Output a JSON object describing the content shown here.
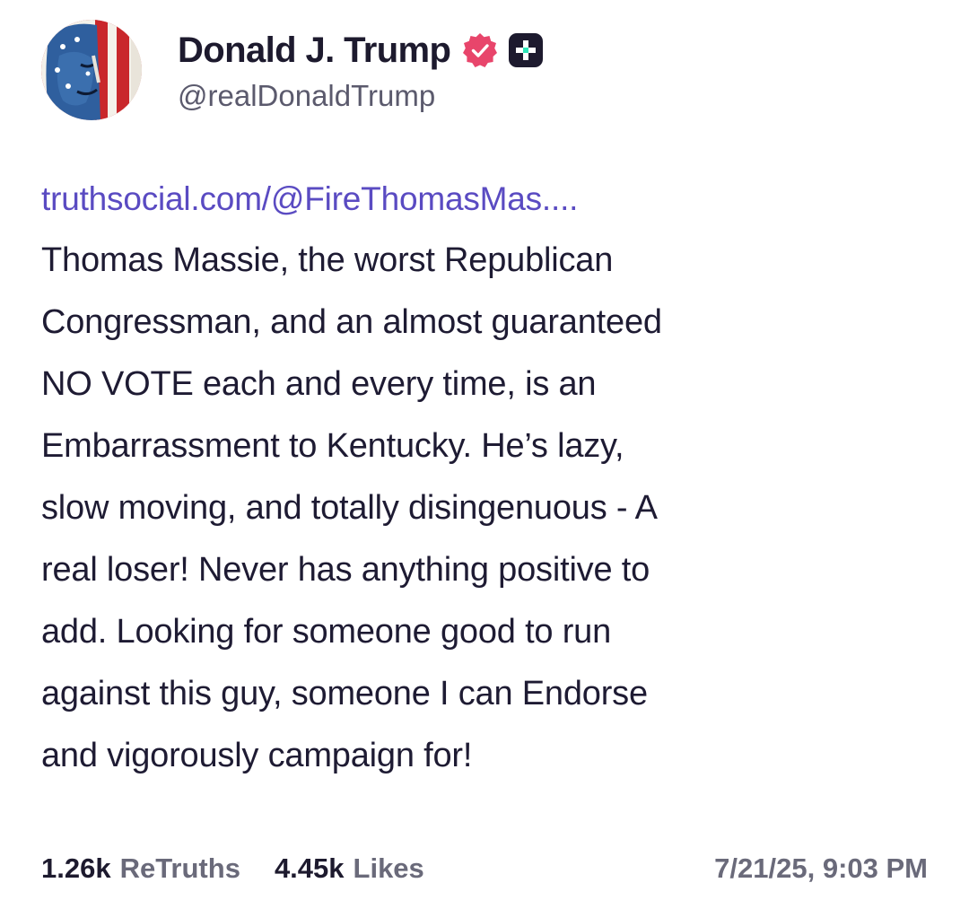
{
  "author": {
    "display_name": "Donald J. Trump",
    "handle": "@realDonaldTrump",
    "verified_icon": "verified-badge-icon",
    "plus_icon": "plus-badge-icon",
    "verified_color": "#e8456b"
  },
  "post": {
    "link_text": "truthsocial.com/@FireThomasMas....",
    "text_lines": [
      "Thomas Massie, the worst Republican",
      "Congressman, and an almost guaranteed",
      "NO VOTE each and every time, is an",
      "Embarrassment to Kentucky. He’s lazy,",
      "slow moving, and totally disingenuous - A",
      "real loser! Never has anything positive to",
      "add. Looking for someone good to run",
      "against this guy, someone I can Endorse",
      "and vigorously campaign for!"
    ]
  },
  "stats": {
    "retruths_count": "1.26k",
    "retruths_label": "ReTruths",
    "likes_count": "4.45k",
    "likes_label": "Likes",
    "timestamp": "7/21/25, 9:03 PM"
  },
  "colors": {
    "link": "#5a4bc2",
    "text": "#1e1b33",
    "muted": "#6a6a7a"
  }
}
